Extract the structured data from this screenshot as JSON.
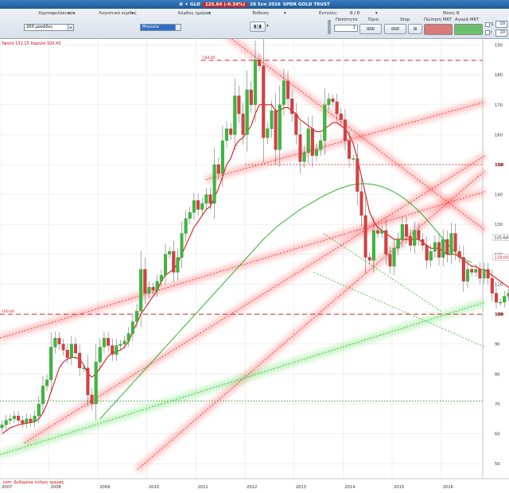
{
  "titlebar": {
    "symbol": "GLD",
    "price_badge": "125.64 (-0.34%)",
    "date": "29 Σεπ 2016",
    "instrument": "SPDR GOLD TRUST"
  },
  "toolbar": {
    "portfolio_label": "Χαρτοφυλάκιο:",
    "portfolio_value": "n/a",
    "accounting_label": "Λογιστικό κέρδος",
    "daily_label": "Κέρδος ημέρας",
    "exposure_label": "Έκθεση:",
    "orders_label": "Εντολές:",
    "orders_value": "0 / 0",
    "position_label": "Θέση:",
    "position_value": "0",
    "period_value": "200 μονάδες",
    "interval_value": "Μηνιαία",
    "quantity_label": "Ποσότητα",
    "quantity_value": "1",
    "limit_label": "Όριο",
    "stop_label": "Stop",
    "sell_label": "Πώληση MKT",
    "buy_label": "Αγορά MKT",
    "right_box_1": "10",
    "right_box_2": "10",
    "right_label_s": "S",
    "right_label_i": "I"
  },
  "chart": {
    "info_text": "Υψηλό 131.15 Χαμηλό 102.43",
    "footnote": ".com. Δεδομένα τέλους ημέρας",
    "price_flag_last": "125.64",
    "price_flag_ma": "119.00",
    "level_high_label": "184.85",
    "level_low_label": "100.00"
  },
  "chart_data": {
    "type": "candlestick",
    "interval": "monthly",
    "title": "",
    "x_tick_labels": [
      "2007",
      "2008",
      "2009",
      "2010",
      "2011",
      "2012",
      "2013",
      "2014",
      "2015",
      "2016"
    ],
    "y_tick_labels": [
      "50",
      "60",
      "70",
      "80",
      "90",
      "100",
      "110",
      "120",
      "130",
      "140",
      "150",
      "160",
      "170",
      "180",
      "190"
    ],
    "ylim": [
      45,
      192
    ],
    "xlim": [
      2007.0,
      2016.85
    ],
    "grid": true,
    "year_start": 2007,
    "closes": [
      63,
      64.5,
      65,
      66,
      64.5,
      63.5,
      65,
      64,
      66,
      70,
      76,
      78,
      89,
      92,
      90,
      88,
      85.5,
      90,
      87,
      82,
      82,
      73,
      70,
      84,
      89,
      92,
      89.5,
      86.5,
      89.5,
      90,
      91,
      93.5,
      97.5,
      101,
      115,
      107,
      109,
      108,
      111,
      113,
      120,
      121,
      114,
      119,
      127,
      132,
      134,
      138,
      135,
      137,
      140,
      137,
      150,
      147,
      158,
      162,
      160,
      173,
      167,
      160,
      175,
      170,
      185,
      183,
      159,
      162,
      168,
      155,
      170,
      178,
      172,
      167,
      160,
      151,
      154,
      162,
      153,
      155,
      158,
      170,
      172,
      171,
      167,
      165,
      158,
      152,
      152,
      141,
      133,
      119,
      118,
      128,
      127,
      128,
      120,
      116,
      122,
      125,
      130,
      126,
      123,
      128,
      125,
      123,
      118,
      121,
      124,
      119,
      125,
      120,
      127,
      121,
      119,
      111,
      115,
      114,
      115,
      112,
      115,
      112,
      107,
      104,
      104,
      106,
      107,
      111,
      107,
      102,
      101,
      106,
      116,
      118,
      122,
      121,
      126,
      129,
      131,
      126,
      125.6
    ],
    "ma_fast": [
      60,
      61,
      62,
      62.5,
      63,
      63.3,
      63.5,
      63.8,
      64,
      65,
      67,
      70,
      74,
      78,
      82,
      84,
      85,
      85.5,
      85.5,
      85,
      83,
      80,
      79,
      80,
      82,
      84,
      86,
      87,
      87.5,
      88,
      89,
      91,
      94,
      97,
      100,
      102,
      104,
      106,
      108,
      111,
      113,
      114,
      115,
      117,
      120,
      123,
      126,
      129,
      131,
      133,
      135,
      136,
      139,
      142,
      146,
      150,
      152,
      156,
      158,
      159,
      161,
      163,
      167,
      170,
      170,
      170,
      170,
      168,
      168,
      169,
      169,
      168,
      167,
      165,
      164,
      163,
      162,
      161,
      161,
      162,
      163,
      164,
      164,
      163,
      162,
      160,
      157,
      152,
      146,
      140,
      134,
      131,
      129,
      128,
      127,
      126,
      125,
      125,
      125,
      125,
      125,
      125,
      125,
      124,
      123,
      122,
      122,
      122,
      121,
      120,
      120,
      120,
      119,
      118,
      117,
      116,
      116,
      115,
      115,
      114,
      113,
      112,
      111,
      110,
      109,
      108,
      107,
      106,
      106,
      107,
      108,
      110,
      112,
      114,
      116,
      118,
      119
    ],
    "ma_slow_start_index": 24,
    "ma_slow": [
      65,
      66.5,
      68,
      69.5,
      71,
      72.5,
      74,
      75.5,
      77,
      78.5,
      80,
      81.5,
      83,
      84.5,
      86,
      87.5,
      89,
      90.5,
      92,
      93.5,
      95,
      96.5,
      98,
      99.5,
      101,
      102.5,
      104,
      105.5,
      107,
      108.5,
      110,
      111.5,
      113,
      114.5,
      116,
      117.5,
      119,
      120.5,
      122,
      123.5,
      125,
      126.3,
      127.6,
      128.9,
      130,
      131,
      132,
      133,
      134,
      135,
      135.8,
      136.6,
      137.4,
      138.2,
      139,
      139.7,
      140.4,
      141,
      141.6,
      142.1,
      142.6,
      143,
      143.3,
      143.5,
      143.6,
      143.6,
      143.5,
      143.3,
      143,
      142.6,
      142.1,
      141.5,
      140.8,
      140,
      139.1,
      138.1,
      137,
      135.8,
      134.5,
      133.1,
      131.6,
      130,
      128.4,
      126.8,
      125.2,
      123.6,
      122.1,
      120.7,
      119.5,
      118.5,
      117.8,
      117.3
    ],
    "horizontal_levels": [
      {
        "value": 184.85,
        "style": "red-dashed",
        "label": "184.85"
      },
      {
        "value": 150,
        "style": "red-dashed-fine",
        "label": ""
      },
      {
        "value": 100,
        "style": "red-dashed",
        "label": "100.00"
      },
      {
        "value": 71,
        "style": "green-dotted",
        "label": ""
      }
    ],
    "trendlines": [
      {
        "from": [
          2011.0,
          201
        ],
        "to": [
          2016.9,
          128
        ],
        "color": "red"
      },
      {
        "from": [
          2011.2,
          145
        ],
        "to": [
          2016.9,
          171
        ],
        "color": "red"
      },
      {
        "from": [
          2007.0,
          92
        ],
        "to": [
          2016.9,
          141
        ],
        "color": "red"
      },
      {
        "from": [
          2007.5,
          57
        ],
        "to": [
          2016.9,
          153
        ],
        "color": "red"
      },
      {
        "from": [
          2009.8,
          48
        ],
        "to": [
          2016.9,
          148
        ],
        "color": "red"
      },
      {
        "from": [
          2007.0,
          53
        ],
        "to": [
          2016.9,
          104
        ],
        "color": "green"
      },
      {
        "from": [
          2013.6,
          127
        ],
        "to": [
          2016.0,
          101
        ],
        "color": "green"
      },
      {
        "from": [
          2013.4,
          114
        ],
        "to": [
          2016.9,
          89
        ],
        "color": "green"
      }
    ]
  },
  "colors": {
    "up_candle": "#3cb83c",
    "down_candle": "#d64040",
    "ma_fast": "#e00000",
    "ma_slow": "#16b016",
    "grid": "#e6e6e6",
    "titlebar": "#1f5b9a",
    "sell_button": "#d87a7a",
    "buy_button": "#6cc06c"
  }
}
